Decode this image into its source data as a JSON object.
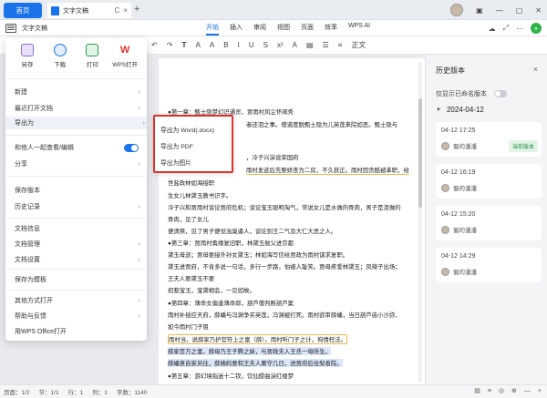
{
  "titlebar": {
    "home_tab": "首页",
    "doc_tab": "文字文稿",
    "reload": "C",
    "close": "×",
    "new_tab": "+",
    "win_controls": [
      "▣",
      "—",
      "▢",
      "✕"
    ]
  },
  "menubar": {
    "file_label": "文字文稿",
    "tabs": [
      "开始",
      "插入",
      "审阅",
      "视图",
      "页面",
      "效率"
    ],
    "ai_label": "WPS AI",
    "right_tools": [
      "☁",
      "⤢",
      "⋯"
    ],
    "share_icon": "+"
  },
  "toolbar": {
    "items": [
      "↶",
      "↷",
      "𝐓",
      "A",
      "A",
      "B",
      "I",
      "U",
      "S",
      "x²",
      "A",
      "▤",
      "☰",
      "≡",
      "正文"
    ]
  },
  "file_menu": {
    "quick": [
      {
        "label": "另存",
        "icon": "save-as-icon"
      },
      {
        "label": "下载",
        "icon": "download-icon"
      },
      {
        "label": "打印",
        "icon": "print-icon"
      },
      {
        "label": "WPS打开",
        "icon": "wps-icon"
      }
    ],
    "items": [
      {
        "label": "新建",
        "chevron": true
      },
      {
        "label": "最近打开文档",
        "chevron": true
      },
      {
        "label": "导出为",
        "chevron": true
      },
      {
        "label": "和他人一起查看/编辑",
        "chevron": false
      },
      {
        "label": "分享",
        "chevron": true
      },
      {
        "label": "保存版本",
        "chevron": false
      },
      {
        "label": "历史记录",
        "chevron": true
      },
      {
        "label": "文档信息",
        "chevron": false
      },
      {
        "label": "文档管理",
        "chevron": true
      },
      {
        "label": "文档设置",
        "chevron": true
      },
      {
        "label": "保存为模板",
        "chevron": false
      },
      {
        "label": "其他方式打开",
        "chevron": true
      },
      {
        "label": "帮助与反馈",
        "chevron": true
      },
      {
        "label": "用WPS Office打开",
        "chevron": false
      }
    ]
  },
  "export_submenu": {
    "items": [
      "导出为 Word(.docx)",
      "导出为 PDF",
      "导出为图片"
    ]
  },
  "document": {
    "lines": [
      "●第一章：甄士隐梦幻识通灵，贾雨村风尘怀闺秀",
      "者还泪之事。僧道度脱甄士隐为儿英莲来院如恶。甄士隐与",
      "，冷子兴演说荣国府",
      "雨村发迹后先娶娇杏为二房，不久获正。雨村因贪酷被革职，给",
      "世盐政林如海授职",
      "生女儿林黛玉教书识字。",
      "冷子兴和贾雨村谈论贾府危机；谈论宝玉聪明淘气，常说女儿是水做的骨肉，男子是泥做的",
      "骨肉，见了女儿",
      "便清爽，见了男子便觉浊臭逼人，谈论到王二气及大仁大恶之人。",
      "●第三章：贾雨村夤缘复旧职，林黛玉抛父进京都",
      "黛玉母逝；贾母要接外孙女黛玉；林如海写信给贾政为雨村谋求复职。",
      "黛玉进贾府，不肯多说一句话，多行一步路，怕被人耻笑。贾母疼爱林黛玉；凤辣子出场；",
      "王夫人要黛玉不要",
      "招惹宝玉，宝黛相会，一见如故。",
      "●第四章：薄命女偏逢薄命郎，葫芦僧判断葫芦案",
      "雨村补授应天府，薛蟠与冯渊争买英莲，冯渊被打死。雨村欲审薛蟠，当日葫芦庙小沙弥、",
      "如今雨村门子阻",
      "雨村当，说薛家乃护官符上之富（薛）。雨村听门子之计，徇情枉法。",
      "薛家百万之富，薛母乃王子腾之妹，与贾政夫人王氏一母所生。",
      "薛蟠意自家另住，薛姨妈要和王夫人厮守几日，进贾府后住梨香院。",
      "●第五章：游幻境指迷十二钗，饮仙醪曲演红楼梦"
    ]
  },
  "history": {
    "title": "历史版本",
    "close": "×",
    "toggle_label": "仅显示已命名版本",
    "date": "2024-04-12",
    "versions": [
      {
        "time": "04-12 17:25",
        "user": "蜀的潘潘",
        "badge": "当前版本"
      },
      {
        "time": "04-12 16:19",
        "user": "蜀的潘潘",
        "badge": ""
      },
      {
        "time": "04-12 15:20",
        "user": "蜀的潘潘",
        "badge": ""
      },
      {
        "time": "04-12 14:29",
        "user": "蜀的潘潘",
        "badge": ""
      }
    ]
  },
  "statusbar": {
    "items": [
      "页面：1/2",
      "节：1/1",
      "行：1",
      "列：1",
      "字数：1140"
    ],
    "right": [
      "▤",
      "≡",
      "◎",
      "⊕",
      "—",
      "+"
    ]
  }
}
